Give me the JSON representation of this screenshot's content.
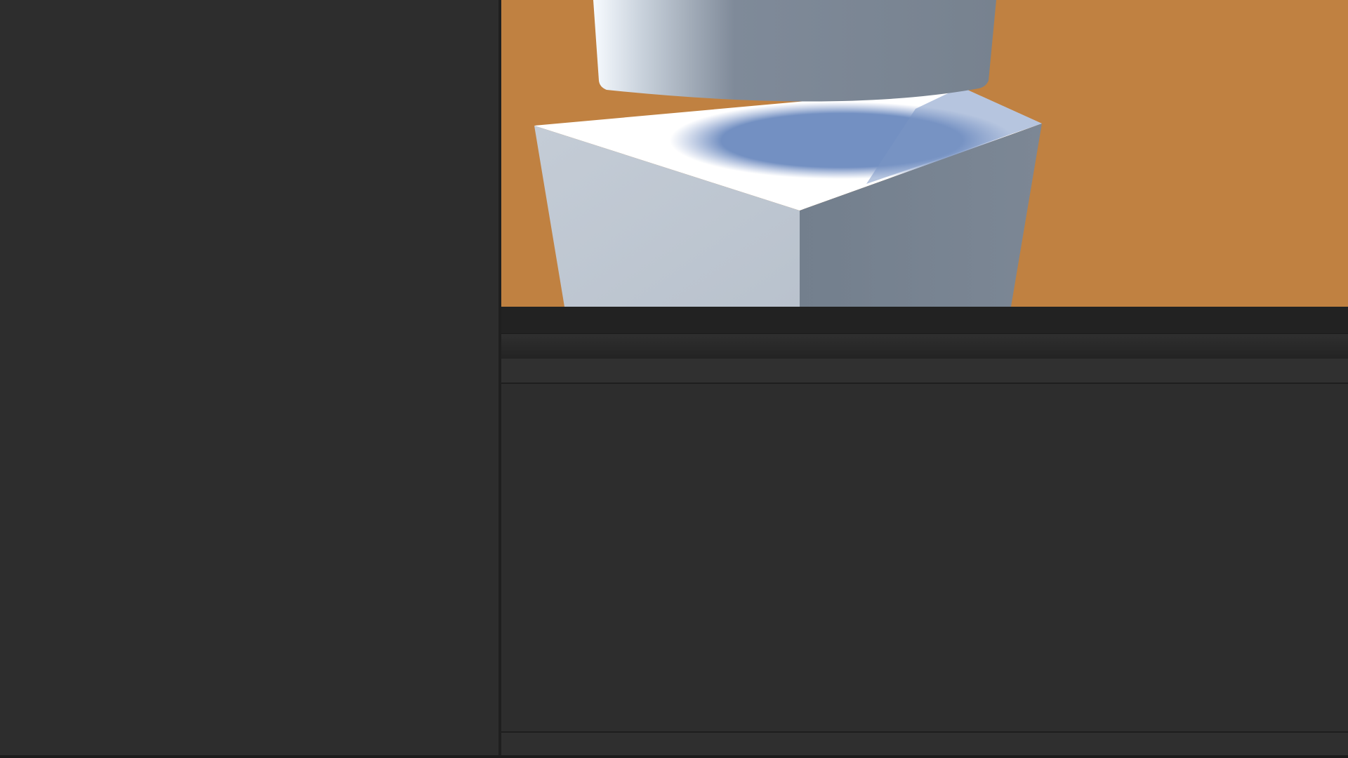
{
  "app": {
    "title": ""
  },
  "viewport": {
    "background_color": "#c08141",
    "objects": [
      "cylinder",
      "cube"
    ]
  },
  "colors": {
    "panel": "#2d2d2d",
    "dark_bar": "#222222",
    "divider": "#1e1e1e"
  }
}
